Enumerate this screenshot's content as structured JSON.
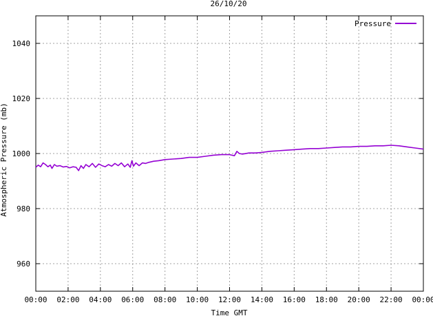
{
  "chart_data": {
    "type": "line",
    "title": "26/10/20",
    "xlabel": "Time GMT",
    "ylabel": "Atmospheric Pressure (mb)",
    "xlim": [
      0,
      24
    ],
    "ylim": [
      950,
      1050
    ],
    "x_ticks": [
      0,
      2,
      4,
      6,
      8,
      10,
      12,
      14,
      16,
      18,
      20,
      22,
      24
    ],
    "x_tick_labels": [
      "00:00",
      "02:00",
      "04:00",
      "06:00",
      "08:00",
      "10:00",
      "12:00",
      "14:00",
      "16:00",
      "18:00",
      "20:00",
      "22:00",
      "00:00"
    ],
    "y_ticks": [
      960,
      980,
      1000,
      1020,
      1040
    ],
    "y_tick_labels": [
      "960",
      "980",
      "1000",
      "1020",
      "1040"
    ],
    "grid": true,
    "legend_position": "top-right",
    "series": [
      {
        "name": "Pressure",
        "color": "#9400d3",
        "x": [
          0.0,
          0.15,
          0.3,
          0.45,
          0.6,
          0.75,
          0.9,
          1.0,
          1.15,
          1.3,
          1.5,
          1.7,
          1.9,
          2.1,
          2.3,
          2.5,
          2.65,
          2.8,
          2.95,
          3.1,
          3.3,
          3.5,
          3.7,
          3.9,
          4.1,
          4.3,
          4.5,
          4.7,
          4.9,
          5.1,
          5.3,
          5.5,
          5.7,
          5.85,
          5.95,
          6.05,
          6.2,
          6.4,
          6.6,
          6.8,
          7.0,
          7.3,
          7.6,
          8.0,
          8.5,
          9.0,
          9.5,
          10.0,
          10.5,
          11.0,
          11.5,
          12.0,
          12.3,
          12.45,
          12.6,
          12.8,
          13.2,
          13.6,
          14.0,
          14.5,
          15.0,
          15.5,
          16.0,
          16.5,
          17.0,
          17.5,
          18.0,
          18.5,
          19.0,
          19.5,
          20.0,
          20.5,
          21.0,
          21.5,
          22.0,
          22.5,
          23.0,
          23.5,
          24.0
        ],
        "values": [
          995.0,
          995.8,
          995.2,
          996.6,
          996.0,
          995.2,
          995.8,
          994.6,
          996.0,
          995.4,
          995.6,
          995.1,
          995.3,
          994.8,
          995.2,
          995.0,
          993.8,
          995.6,
          994.6,
          996.0,
          995.2,
          996.4,
          995.0,
          996.2,
          995.6,
          995.2,
          996.0,
          995.4,
          996.4,
          995.6,
          996.6,
          995.2,
          996.2,
          995.0,
          997.4,
          995.4,
          996.6,
          995.6,
          996.6,
          996.4,
          996.8,
          997.2,
          997.4,
          997.8,
          998.0,
          998.2,
          998.6,
          998.6,
          999.0,
          999.4,
          999.6,
          999.6,
          999.2,
          1000.8,
          1000.0,
          999.8,
          1000.2,
          1000.2,
          1000.4,
          1000.8,
          1001.0,
          1001.2,
          1001.4,
          1001.6,
          1001.8,
          1001.8,
          1002.0,
          1002.2,
          1002.4,
          1002.4,
          1002.6,
          1002.6,
          1002.8,
          1002.8,
          1003.0,
          1002.8,
          1002.4,
          1002.0,
          1001.6
        ]
      }
    ]
  }
}
